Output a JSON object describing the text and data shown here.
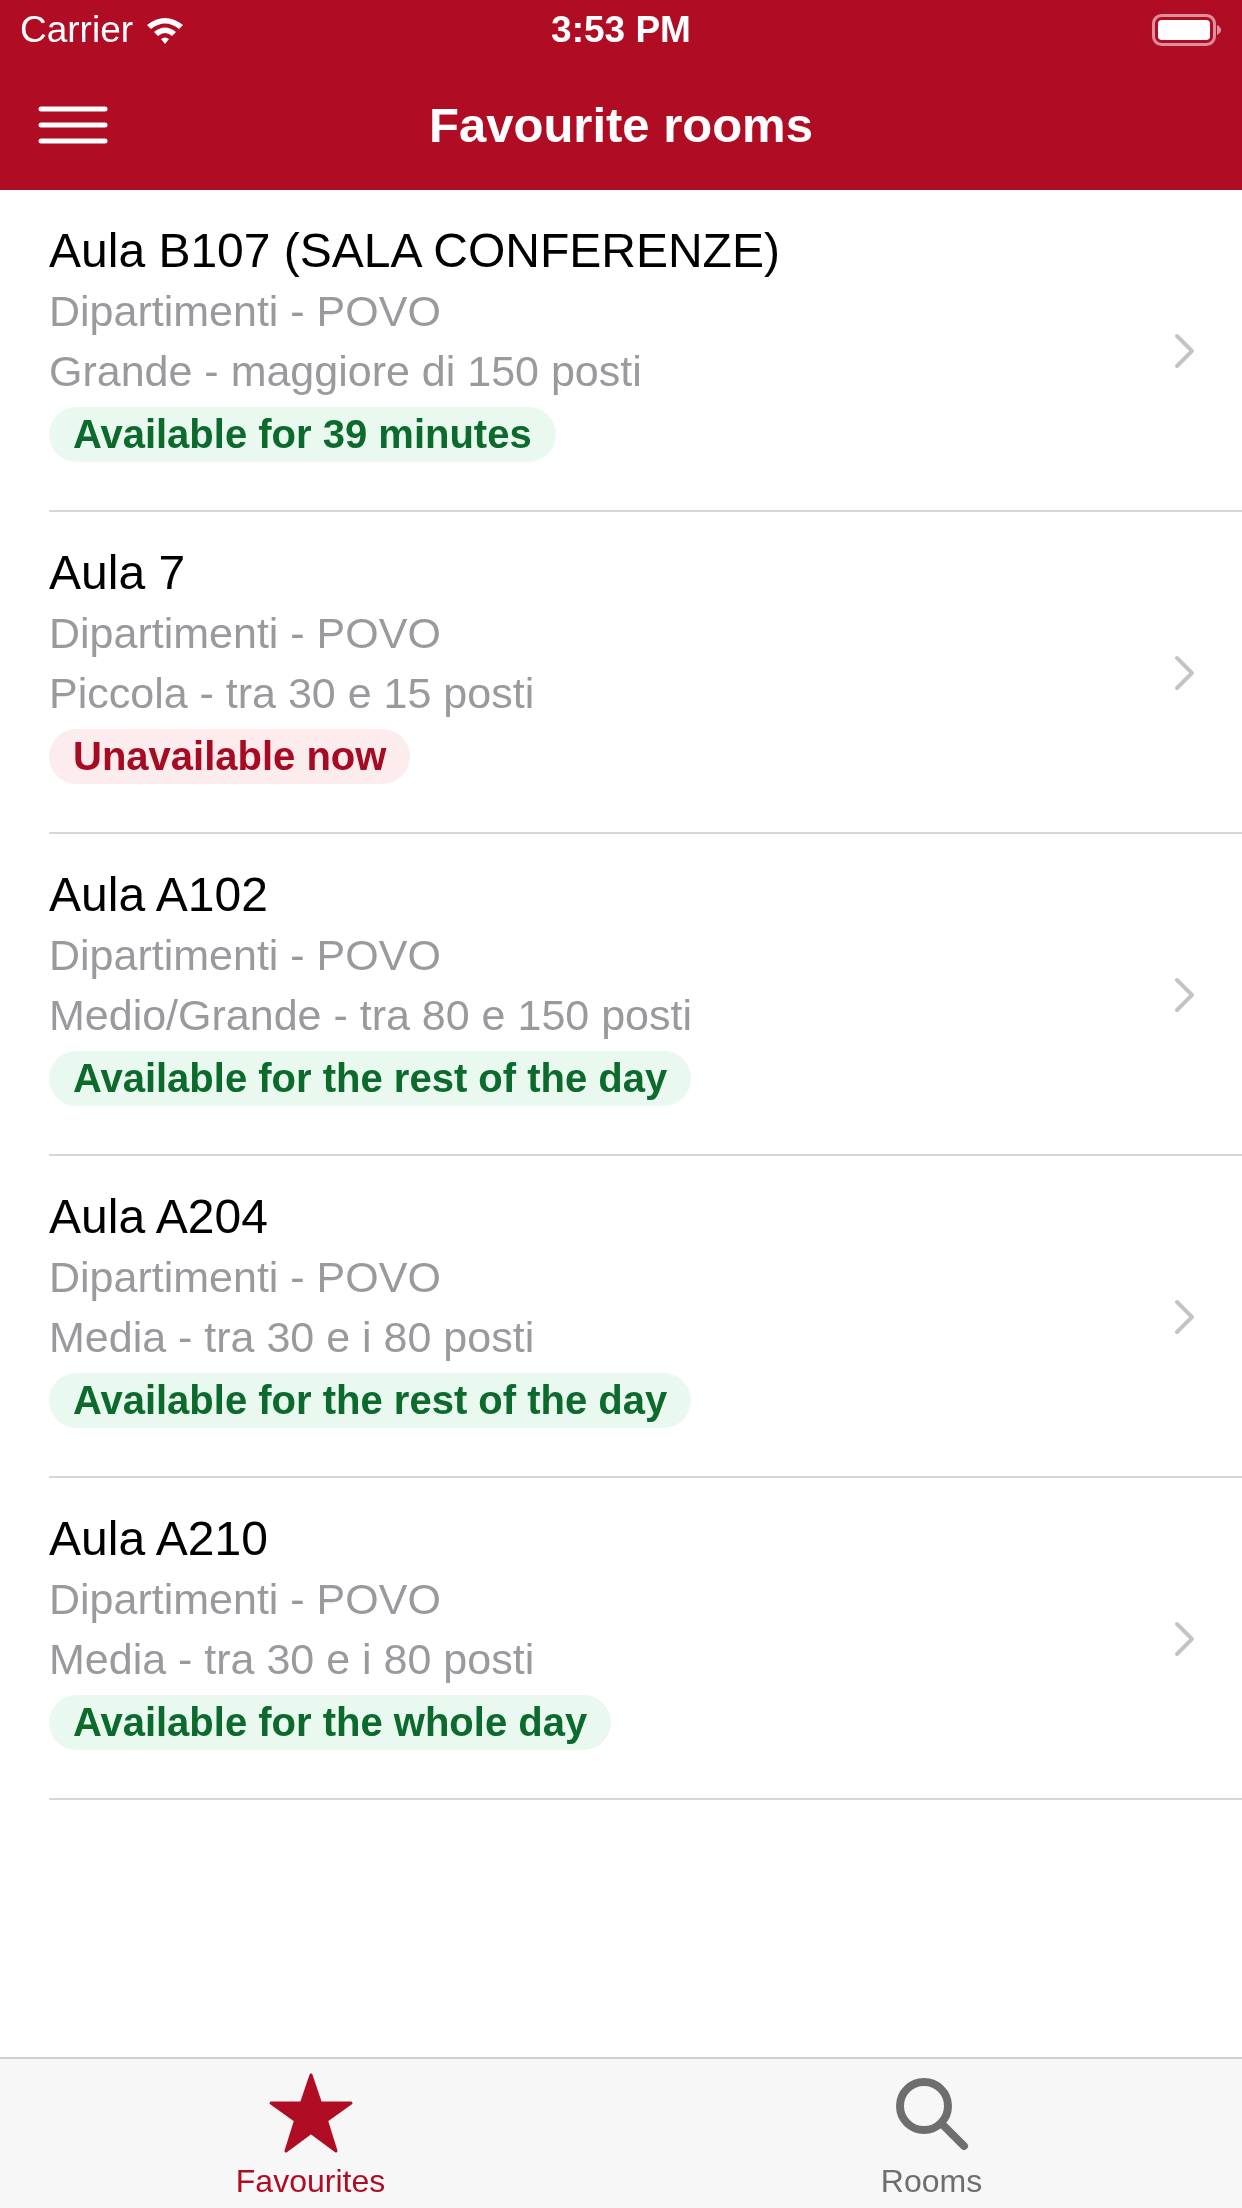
{
  "status_bar": {
    "carrier": "Carrier",
    "time": "3:53 PM"
  },
  "nav_bar": {
    "title": "Favourite rooms"
  },
  "rooms": [
    {
      "name": "Aula B107 (SALA CONFERENZE)",
      "location": "Dipartimenti - POVO",
      "size": "Grande - maggiore di 150 posti",
      "availability": {
        "text": "Available for 39 minutes",
        "available": true
      }
    },
    {
      "name": "Aula 7",
      "location": "Dipartimenti - POVO",
      "size": "Piccola - tra 30 e 15 posti",
      "availability": {
        "text": "Unavailable now",
        "available": false
      }
    },
    {
      "name": "Aula A102",
      "location": "Dipartimenti - POVO",
      "size": "Medio/Grande - tra 80 e 150 posti",
      "availability": {
        "text": "Available for the rest of the day",
        "available": true
      }
    },
    {
      "name": "Aula A204",
      "location": "Dipartimenti - POVO",
      "size": "Media - tra 30 e i 80 posti",
      "availability": {
        "text": "Available for the rest of the day",
        "available": true
      }
    },
    {
      "name": "Aula A210",
      "location": "Dipartimenti - POVO",
      "size": "Media - tra 30 e i 80 posti",
      "availability": {
        "text": "Available for the whole day",
        "available": true
      }
    }
  ],
  "tab_bar": {
    "tabs": [
      {
        "label": "Favourites",
        "selected": true
      },
      {
        "label": "Rooms",
        "selected": false
      }
    ]
  }
}
